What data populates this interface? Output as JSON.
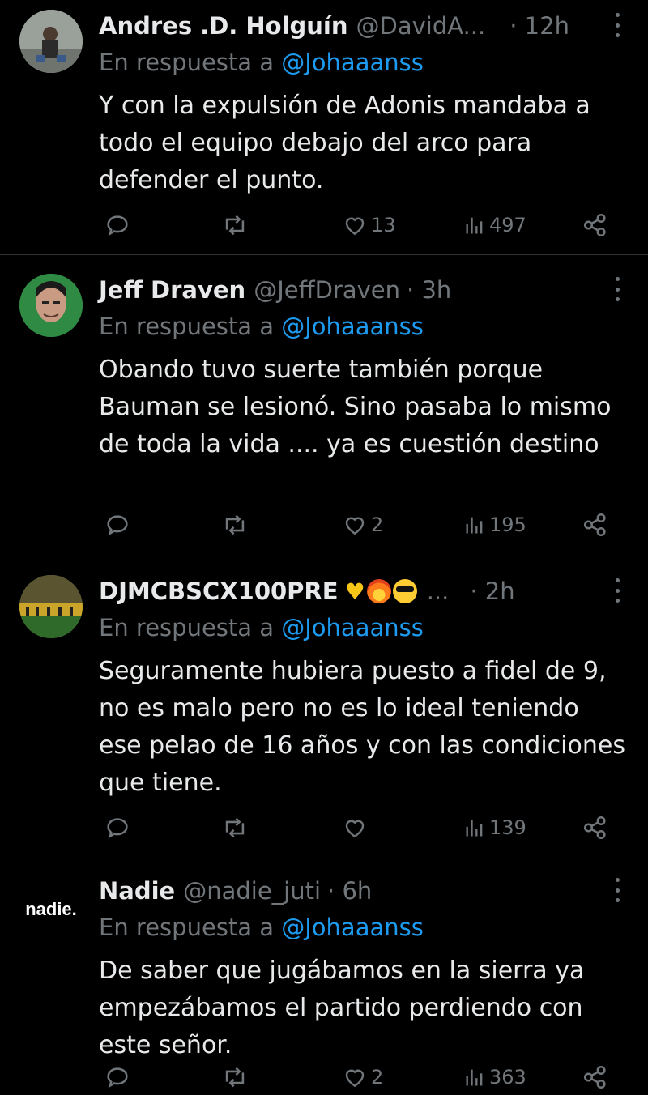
{
  "reply_prefix": "En respuesta a",
  "tweets": [
    {
      "name": "Andres .D. Holguín",
      "handle": "@DavidA...",
      "time": "· 12h",
      "reply_to": "@Johaaanss",
      "text": "Y con la expulsión de Adonis mandaba a todo el equipo debajo del arco para defender el punto.",
      "likes": "13",
      "views": "497"
    },
    {
      "name": "Jeff Draven",
      "handle": "@JeffDraven",
      "time": "· 3h",
      "reply_to": "@Johaaanss",
      "text": "Obando tuvo suerte también porque Bauman se lesionó.  Sino pasaba lo mismo de toda la vida .... ya es cuestión destino",
      "likes": "2",
      "views": "195"
    },
    {
      "name": "DJMCBSCX100PRE",
      "name_suffix": "...",
      "handle": "",
      "time": "· 2h",
      "reply_to": "@Johaaanss",
      "text": "Seguramente hubiera puesto a fidel de 9, no es malo pero no es lo ideal teniendo ese pelao de 16 años y con las condiciones que tiene.",
      "likes": "",
      "views": "139"
    },
    {
      "name": "Nadie",
      "handle": "@nadie_juti",
      "time": "· 6h",
      "reply_to": "@Johaaanss",
      "avatar_text": "nadie.",
      "text": "De saber que jugábamos en la sierra ya empezábamos el partido perdiendo con este señor.",
      "likes": "2",
      "views": "363"
    }
  ],
  "colors": {
    "background": "#000000",
    "primary_text": "#e7e9ea",
    "secondary_text": "#71767b",
    "link": "#1d9bf0",
    "divider": "#2f3336"
  },
  "icons": [
    "reply-icon",
    "retweet-icon",
    "like-icon",
    "views-icon",
    "share-icon",
    "more-icon"
  ]
}
